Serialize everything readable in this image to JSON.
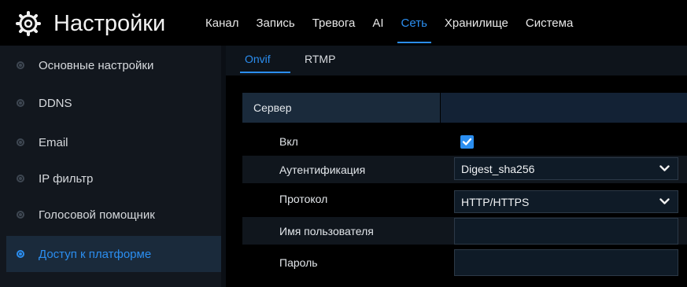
{
  "header": {
    "title": "Настройки",
    "tabs": [
      {
        "label": "Канал"
      },
      {
        "label": "Запись"
      },
      {
        "label": "Тревога"
      },
      {
        "label": "AI"
      },
      {
        "label": "Сеть"
      },
      {
        "label": "Хранилище"
      },
      {
        "label": "Система"
      }
    ],
    "active_tab": "Сеть"
  },
  "sidebar": {
    "items": [
      {
        "label": "Основные настройки"
      },
      {
        "label": "DDNS"
      },
      {
        "label": "Email"
      },
      {
        "label": "IP фильтр"
      },
      {
        "label": "Голосовой помощник"
      },
      {
        "label": "Доступ к платформе"
      }
    ],
    "active_item": "Доступ к платформе"
  },
  "subtabs": {
    "items": [
      {
        "label": "Onvif"
      },
      {
        "label": "RTMP"
      }
    ],
    "active": "Onvif"
  },
  "form": {
    "section_title": "Сервер",
    "enable": {
      "label": "Вкл",
      "checked": true
    },
    "auth": {
      "label": "Аутентификация",
      "value": "Digest_sha256"
    },
    "protocol": {
      "label": "Протокол",
      "value": "HTTP/HTTPS"
    },
    "username": {
      "label": "Имя пользователя",
      "value": ""
    },
    "password": {
      "label": "Пароль",
      "value": ""
    }
  },
  "colors": {
    "accent": "#2b8ef0",
    "background": "#000000",
    "sidebar": "#12171e",
    "active_row": "#1a2a3b"
  },
  "icons": {
    "header": "gear-icon",
    "sidebar": "bullet-icon",
    "checkbox": "checkmark-icon",
    "select": "chevron-down-icon"
  }
}
